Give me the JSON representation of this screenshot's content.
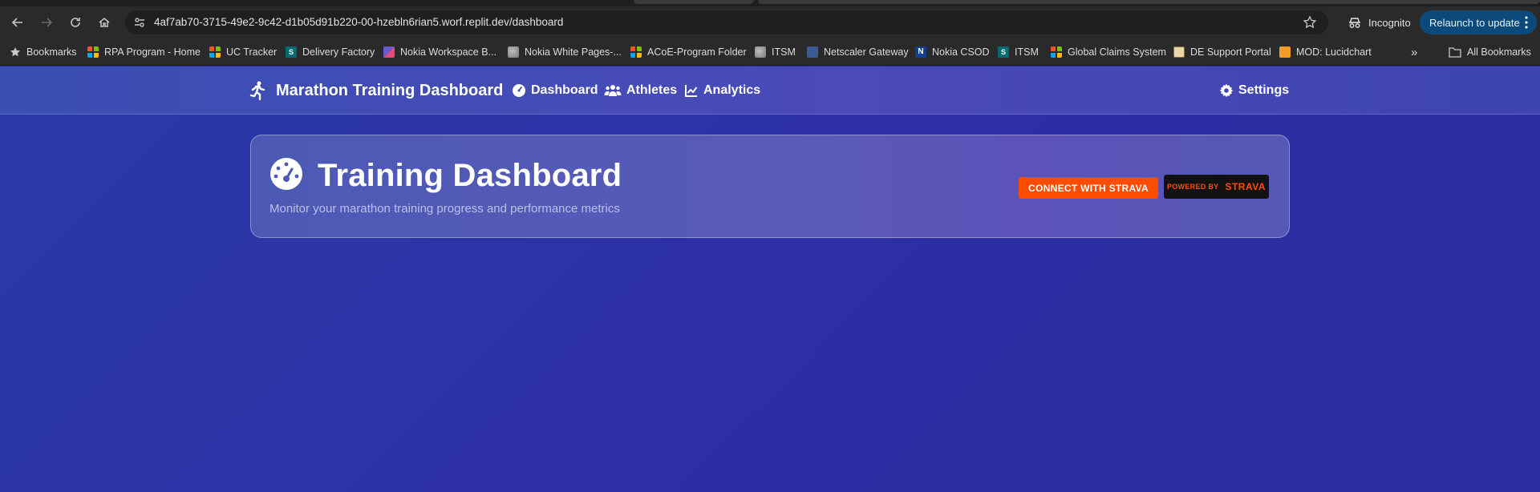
{
  "browser": {
    "url": "4af7ab70-3715-49e2-9c42-d1b05d91b220-00-hzebln6rian5.worf.replit.dev/dashboard",
    "profile_label": "Incognito",
    "relaunch_label": "Relaunch to update"
  },
  "bookmarks": {
    "items": [
      {
        "label": "Bookmarks",
        "icon": "star-icon"
      },
      {
        "label": "RPA Program - Home",
        "icon": "microsoft-icon"
      },
      {
        "label": "UC Tracker",
        "icon": "microsoft-icon"
      },
      {
        "label": "Delivery Factory",
        "icon": "sharepoint-icon"
      },
      {
        "label": "Nokia Workspace B...",
        "icon": "workspace-icon"
      },
      {
        "label": "Nokia White Pages-...",
        "icon": "globe-icon"
      },
      {
        "label": "ACoE-Program Folder",
        "icon": "microsoft-icon"
      },
      {
        "label": "ITSM",
        "icon": "globe-icon"
      },
      {
        "label": "Netscaler Gateway",
        "icon": "lock-icon"
      },
      {
        "label": "Nokia CSOD",
        "icon": "nokia-icon"
      },
      {
        "label": "ITSM",
        "icon": "sharepoint-icon"
      },
      {
        "label": "Global Claims System",
        "icon": "microsoft-icon"
      },
      {
        "label": "DE Support Portal",
        "icon": "portal-icon"
      },
      {
        "label": "MOD: Lucidchart",
        "icon": "lucidchart-icon"
      }
    ],
    "overflow_label": "»",
    "all_bookmarks_label": "All Bookmarks"
  },
  "app": {
    "brand": "Marathon Training Dashboard",
    "nav": {
      "dashboard": "Dashboard",
      "athletes": "Athletes",
      "analytics": "Analytics",
      "settings": "Settings"
    },
    "hero": {
      "title": "Training Dashboard",
      "subtitle": "Monitor your marathon training progress and performance metrics",
      "connect_label": "CONNECT WITH STRAVA",
      "powered_by": "POWERED BY",
      "strava": "STRAVA"
    },
    "colors": {
      "strava_orange": "#fc4c02",
      "background": "#2b2e9e"
    }
  }
}
